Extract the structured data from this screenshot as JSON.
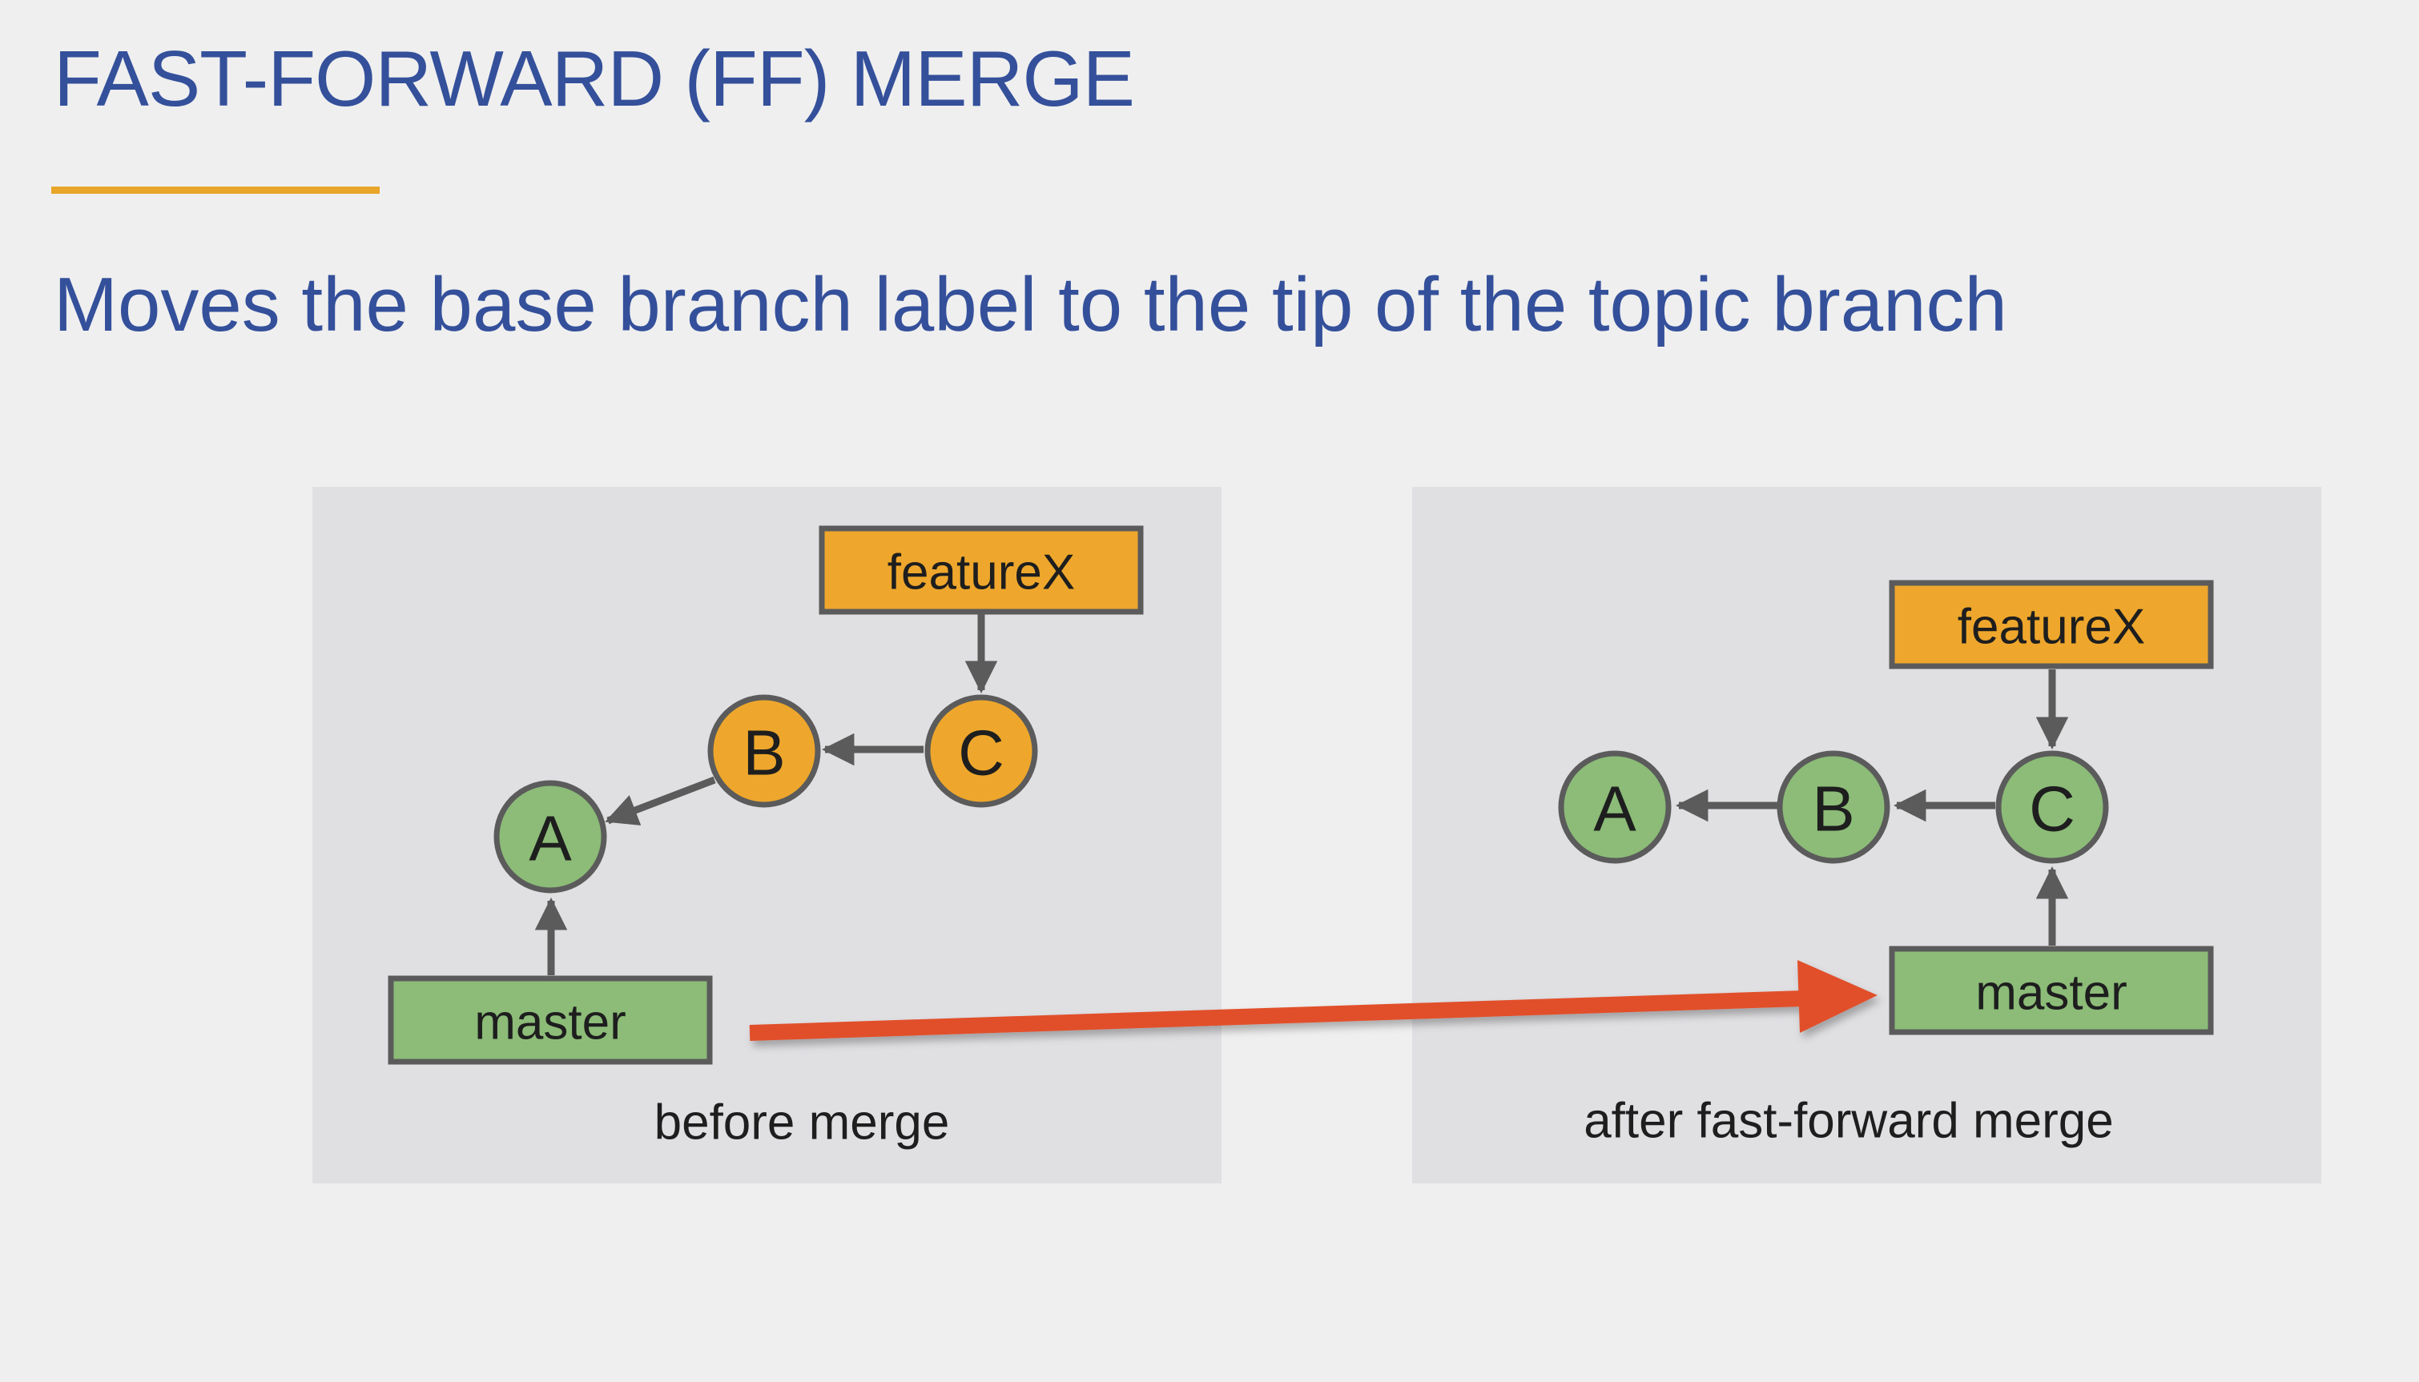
{
  "slide": {
    "title": "FAST-FORWARD (FF) MERGE",
    "subtitle": "Moves the base branch label to the tip of the topic branch"
  },
  "colors": {
    "title_text": "#34509b",
    "title_rule": "#e8a528",
    "panel_background": "#e0e0e3",
    "commit_green": "#8cbc78",
    "commit_orange": "#eea72c",
    "outline": "#5b5b5b",
    "move_arrow": "#e1502c"
  },
  "before_panel": {
    "caption": "before merge",
    "commits": {
      "a": {
        "label": "A",
        "color": "green"
      },
      "b": {
        "label": "B",
        "color": "orange"
      },
      "c": {
        "label": "C",
        "color": "orange"
      }
    },
    "branches": {
      "feature": {
        "label": "featureX",
        "color": "orange",
        "points_to": "C"
      },
      "master": {
        "label": "master",
        "color": "green",
        "points_to": "A"
      }
    }
  },
  "after_panel": {
    "caption": "after fast-forward merge",
    "commits": {
      "a": {
        "label": "A",
        "color": "green"
      },
      "b": {
        "label": "B",
        "color": "green"
      },
      "c": {
        "label": "C",
        "color": "green"
      }
    },
    "branches": {
      "feature": {
        "label": "featureX",
        "color": "orange",
        "points_to": "C"
      },
      "master": {
        "label": "master",
        "color": "green",
        "points_to": "C"
      }
    }
  },
  "transition": {
    "icon": "arrow-right-icon",
    "from": "before master label",
    "to": "after master label"
  }
}
